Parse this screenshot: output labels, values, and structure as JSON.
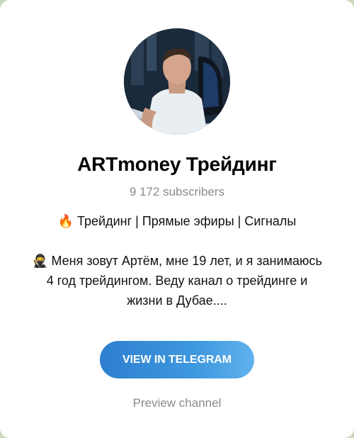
{
  "channel": {
    "title": "ARTmoney Трейдинг",
    "subscribers": "9 172 subscribers",
    "avatar_icon": "channel-avatar-photo"
  },
  "description": {
    "line1": "🔥 Трейдинг | Прямые эфиры | Сигналы",
    "line2": "🥷 Меня зовут Артём, мне 19 лет, и я занимаюсь",
    "line3": "4 год трейдингом. Веду канал о трейдинге и",
    "line4": "жизни в Дубае...."
  },
  "actions": {
    "view_button": "VIEW IN TELEGRAM",
    "preview_link": "Preview channel"
  },
  "colors": {
    "button_gradient_start": "#2f7fd0",
    "button_gradient_end": "#60b2ee",
    "muted_text": "#8a8a8a",
    "background": "#ffffff"
  }
}
